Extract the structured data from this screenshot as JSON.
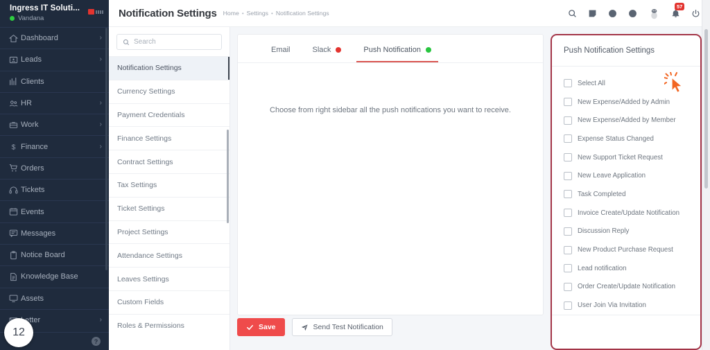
{
  "sidebar": {
    "brand_name": "Ingress IT Soluti...",
    "user_name": "Vandana",
    "items": [
      {
        "label": "Dashboard",
        "icon": "home-icon",
        "caret": "›"
      },
      {
        "label": "Leads",
        "icon": "leads-icon",
        "caret": "›"
      },
      {
        "label": "Clients",
        "icon": "clients-icon",
        "caret": ""
      },
      {
        "label": "HR",
        "icon": "hr-icon",
        "caret": "›"
      },
      {
        "label": "Work",
        "icon": "work-icon",
        "caret": "›"
      },
      {
        "label": "Finance",
        "icon": "finance-icon",
        "caret": "›"
      },
      {
        "label": "Orders",
        "icon": "orders-icon",
        "caret": ""
      },
      {
        "label": "Tickets",
        "icon": "tickets-icon",
        "caret": ""
      },
      {
        "label": "Events",
        "icon": "events-icon",
        "caret": ""
      },
      {
        "label": "Messages",
        "icon": "messages-icon",
        "caret": ""
      },
      {
        "label": "Notice Board",
        "icon": "notice-board-icon",
        "caret": ""
      },
      {
        "label": "Knowledge Base",
        "icon": "knowledge-base-icon",
        "caret": ""
      },
      {
        "label": "Assets",
        "icon": "assets-icon",
        "caret": ""
      },
      {
        "label": "Letter",
        "icon": "letter-icon",
        "caret": "›"
      }
    ],
    "help_label": "?",
    "step_badge": "12"
  },
  "header": {
    "title": "Notification Settings",
    "breadcrumb": [
      "Home",
      "Settings",
      "Notification Settings"
    ],
    "separator": "•",
    "icons": [
      "search-icon",
      "note-icon",
      "clock-icon",
      "plus-circle-icon",
      "avatar-icon",
      "bell-icon",
      "power-icon"
    ],
    "notification_count": "57"
  },
  "settings_nav": {
    "search_placeholder": "Search",
    "search_value": "",
    "items": [
      "Notification Settings",
      "Currency Settings",
      "Payment Credentials",
      "Finance Settings",
      "Contract Settings",
      "Tax Settings",
      "Ticket Settings",
      "Project Settings",
      "Attendance Settings",
      "Leaves Settings",
      "Custom Fields",
      "Roles & Permissions"
    ],
    "active_index": 0
  },
  "main": {
    "tabs": [
      {
        "label": "Email",
        "dot": "",
        "active": false
      },
      {
        "label": "Slack",
        "dot": "#e3342f",
        "active": false
      },
      {
        "label": "Push Notification",
        "dot": "#28c53f",
        "active": true
      }
    ],
    "hint": "Choose from right sidebar all the push notifications you want to receive.",
    "save_label": "Save",
    "test_label": "Send Test Notification"
  },
  "right_panel": {
    "title": "Push Notification Settings",
    "options": [
      "Select All",
      "New Expense/Added by Admin",
      "New Expense/Added by Member",
      "Expense Status Changed",
      "New Support Ticket Request",
      "New Leave Application",
      "Task Completed",
      "Invoice Create/Update Notification",
      "Discussion Reply",
      "New Product Purchase Request",
      "Lead notification",
      "Order Create/Update Notification",
      "User Join Via Invitation"
    ],
    "border_color": "#a33447"
  },
  "colors": {
    "sidebar_bg": "#1f2b3d",
    "accent_red": "#ef4b4b",
    "highlight_border": "#a33447",
    "cursor": "#f26522"
  }
}
